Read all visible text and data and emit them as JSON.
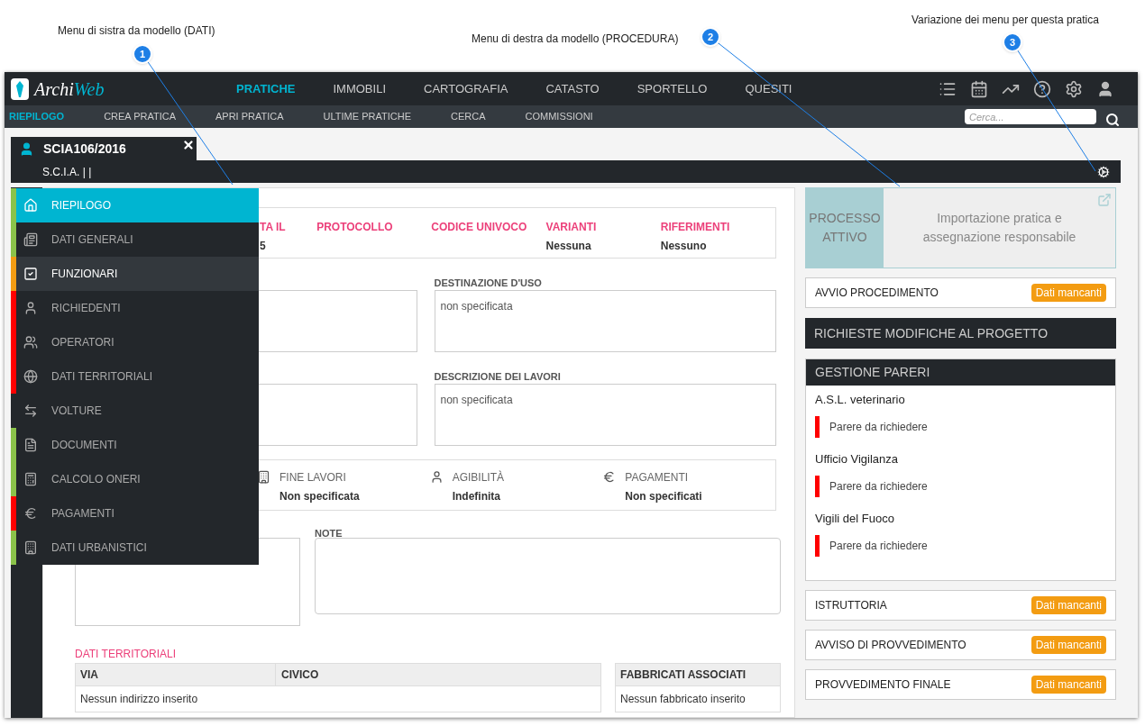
{
  "annotations": [
    {
      "number": "1",
      "text": "Menu di sistra da modello (DATI)"
    },
    {
      "number": "2",
      "text": "Menu di destra da modello (PROCEDURA)"
    },
    {
      "number": "3",
      "text": "Variazione dei menu per questa pratica"
    }
  ],
  "app": {
    "logo_text": [
      "Archi",
      "Web"
    ],
    "main_menu": [
      {
        "label": "PRATICHE",
        "selected": true
      },
      {
        "label": "IMMOBILI",
        "selected": false
      },
      {
        "label": "CARTOGRAFIA",
        "selected": false
      },
      {
        "label": "CATASTO",
        "selected": false
      },
      {
        "label": "SPORTELLO",
        "selected": false
      },
      {
        "label": "QUESITI",
        "selected": false
      }
    ],
    "sub_menu": [
      {
        "label": "RIEPILOGO",
        "selected": true
      },
      {
        "label": "CREA PRATICA",
        "selected": false
      },
      {
        "label": "APRI PRATICA",
        "selected": false
      },
      {
        "label": "ULTIME PRATICHE",
        "selected": false
      },
      {
        "label": "CERCA",
        "selected": false
      },
      {
        "label": "COMMISSIONI",
        "selected": false
      }
    ],
    "search": {
      "placeholder": "Cerca..."
    }
  },
  "pratica": {
    "code": "SCIA106/2016",
    "subtitle": "S.C.I.A. | |"
  },
  "left_menu": [
    {
      "label": "RIEPILOGO",
      "selected": true,
      "highlighted": false,
      "color": "#8bc34a"
    },
    {
      "label": "DATI GENERALI",
      "selected": false,
      "highlighted": false,
      "color": "#8bc34a"
    },
    {
      "label": "FUNZIONARI",
      "selected": false,
      "highlighted": true,
      "color": "#f39c12"
    },
    {
      "label": "RICHIEDENTI",
      "selected": false,
      "highlighted": false,
      "color": "#ff0000"
    },
    {
      "label": "OPERATORI",
      "selected": false,
      "highlighted": false,
      "color": "#ff0000"
    },
    {
      "label": "DATI TERRITORIALI",
      "selected": false,
      "highlighted": false,
      "color": "#ff0000"
    },
    {
      "label": "VOLTURE",
      "selected": false,
      "highlighted": false,
      "color": "#23272b"
    },
    {
      "label": "DOCUMENTI",
      "selected": false,
      "highlighted": false,
      "color": "#8bc34a"
    },
    {
      "label": "CALCOLO ONERI",
      "selected": false,
      "highlighted": false,
      "color": "#8bc34a"
    },
    {
      "label": "PAGAMENTI",
      "selected": false,
      "highlighted": false,
      "color": "#ff0000"
    },
    {
      "label": "DATI URBANISTICI",
      "selected": false,
      "highlighted": false,
      "color": "#8bc34a"
    }
  ],
  "summary": [
    {
      "heading": "TA IL",
      "value": "5"
    },
    {
      "heading": "PROTOCOLLO"
    },
    {
      "heading": "CODICE UNIVOCO"
    },
    {
      "heading": "VARIANTI",
      "value": "Nessuna"
    },
    {
      "heading": "RIFERIMENTI",
      "value": "Nessuno"
    }
  ],
  "fields": [
    {
      "label": "DESTINAZIONE D'USO",
      "value": "non specificata"
    },
    {
      "label": "DESCRIZIONE DEI LAVORI",
      "value": "non specificata"
    }
  ],
  "status": [
    {
      "kind": "building",
      "label": "FINE LAVORI",
      "value": "Non specificata"
    },
    {
      "kind": "user",
      "label": "AGIBILITÀ",
      "value": "Indefinita"
    },
    {
      "kind": "euro",
      "label": "PAGAMENTI",
      "value": "Non specificati"
    }
  ],
  "note": {
    "label": "NOTE"
  },
  "territorial": {
    "title": "DATI TERRITORIALI",
    "address_table": {
      "columns": [
        "VIA",
        "CIVICO"
      ],
      "empty": "Nessun indirizzo inserito"
    },
    "buildings_table": {
      "columns": [
        "FABBRICATI ASSOCIATI"
      ],
      "empty": "Nessun fabbricato inserito"
    }
  },
  "process": {
    "label": "PROCESSO ATTIVO",
    "description": "Importazione pratica e assegnazione responsabile"
  },
  "steps": [
    {
      "kind": "step",
      "title": "AVVIO PROCEDIMENTO",
      "badge": "Dati mancanti"
    },
    {
      "kind": "section",
      "title": "RICHIESTE MODIFICHE AL PROGETTO"
    },
    {
      "kind": "group",
      "title": "GESTIONE PARERI",
      "items": [
        {
          "name": "A.S.L. veterinario",
          "status": "Parere da richiedere",
          "color": "#ff0000"
        },
        {
          "name": "Ufficio Vigilanza",
          "status": "Parere da richiedere",
          "color": "#ff0000"
        },
        {
          "name": "Vigili del Fuoco",
          "status": "Parere da richiedere",
          "color": "#ff0000"
        }
      ]
    },
    {
      "kind": "step",
      "title": "ISTRUTTORIA",
      "badge": "Dati mancanti"
    },
    {
      "kind": "step",
      "title": "AVVISO DI PROVVEDIMENTO",
      "badge": "Dati mancanti"
    },
    {
      "kind": "step",
      "title": "PROVVEDIMENTO FINALE",
      "badge": "Dati mancanti"
    }
  ]
}
